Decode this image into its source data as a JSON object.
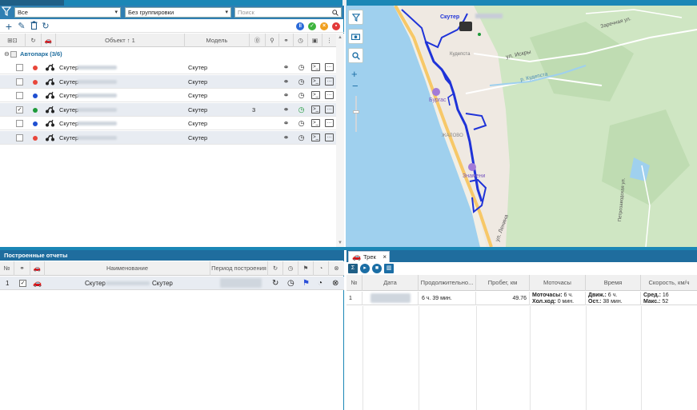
{
  "filters": {
    "status_value": "Все",
    "grouping_value": "Без группировки",
    "search_placeholder": "Поиск"
  },
  "grid": {
    "col_object": "Объект ↑ 1",
    "col_model": "Модель",
    "group_label": "Автопарк (3/6)",
    "rows": [
      {
        "name": "Скутер",
        "model": "Скутер",
        "status_color": "#e8463a",
        "checked": false,
        "count": ""
      },
      {
        "name": "Скутер",
        "model": "Скутер",
        "status_color": "#e8463a",
        "checked": false,
        "count": ""
      },
      {
        "name": "Скутер",
        "model": "Скутер",
        "status_color": "#1f4fd1",
        "checked": false,
        "count": ""
      },
      {
        "name": "Скутер",
        "model": "Скутер",
        "status_color": "#1e9a3a",
        "checked": true,
        "count": "3"
      },
      {
        "name": "Скутер",
        "model": "Скутер",
        "status_color": "#1f4fd1",
        "checked": false,
        "count": ""
      },
      {
        "name": "Скутер",
        "model": "Скутер",
        "status_color": "#e8463a",
        "checked": false,
        "count": ""
      }
    ]
  },
  "map": {
    "marker_label": "Скутер",
    "labels": {
      "street_iskry": "ул. Искры",
      "zarechnaya": "Заречная ул.",
      "kudepsta": "Кудепста",
      "burgas": "Бургас",
      "znamenie": "Знамени",
      "river": "р. Кудепста",
      "kalovo": "ЖАЛОВО",
      "lenina": "ул. Ленина",
      "petrozavodskaya": "Петрозаводская ул."
    }
  },
  "reports": {
    "title": "Построенные отчеты",
    "col_num": "№",
    "col_name": "Наименование",
    "col_period": "Период построения",
    "row": {
      "num": "1",
      "name_left": "Скутер",
      "name_right": "Скутер"
    }
  },
  "track": {
    "tab_label": "Трек",
    "col_num": "№",
    "col_date": "Дата",
    "col_duration": "Продолжительно...",
    "col_mileage": "Пробег, км",
    "col_moto": "Моточасы",
    "col_time": "Время",
    "col_speed": "Скорость, км/ч",
    "row": {
      "num": "1",
      "duration": "6 ч. 39 мин.",
      "mileage": "49.76",
      "moto_label1": "Моточасы:",
      "moto_val1": "6 ч.",
      "moto_label2": "Хол.ход:",
      "moto_val2": "0 мин.",
      "time_label1": "Движ.:",
      "time_val1": "6 ч.",
      "time_label2": "Ост.:",
      "time_val2": "38 мин.",
      "speed_label1": "Сред.:",
      "speed_val1": "16",
      "speed_label2": "Макс.:",
      "speed_val2": "52"
    }
  }
}
